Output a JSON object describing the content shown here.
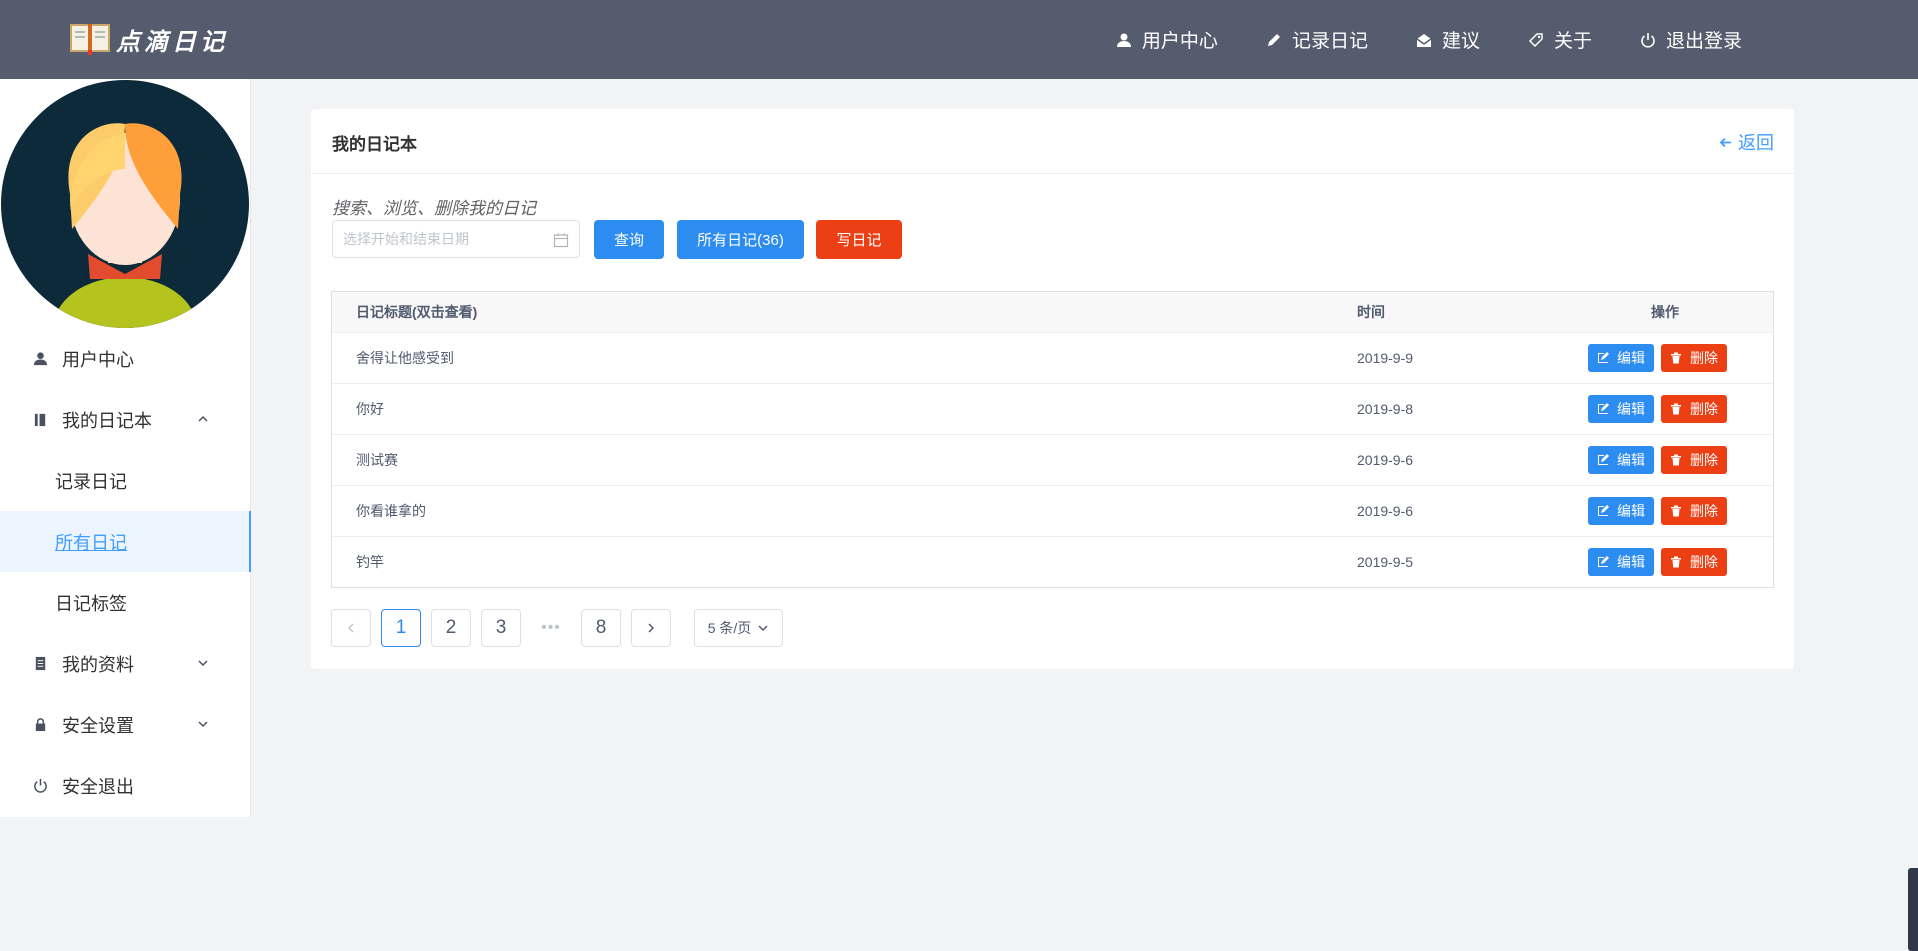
{
  "header": {
    "app_name": "点滴日记",
    "nav": [
      {
        "label": "用户中心",
        "icon": "user-icon"
      },
      {
        "label": "记录日记",
        "icon": "pencil-icon"
      },
      {
        "label": "建议",
        "icon": "mail-open-icon"
      },
      {
        "label": "关于",
        "icon": "tag-icon"
      },
      {
        "label": "退出登录",
        "icon": "power-icon"
      }
    ]
  },
  "sidebar": {
    "items": [
      {
        "label": "用户中心",
        "icon": "user-icon"
      },
      {
        "label": "我的日记本",
        "icon": "book-icon",
        "expanded": true
      },
      {
        "label": "记录日记"
      },
      {
        "label": "所有日记",
        "active": true
      },
      {
        "label": "日记标签"
      },
      {
        "label": "我的资料",
        "icon": "notebook-icon",
        "expanded": false
      },
      {
        "label": "安全设置",
        "icon": "lock-icon",
        "expanded": false
      },
      {
        "label": "安全退出",
        "icon": "power-icon"
      }
    ]
  },
  "main": {
    "title": "我的日记本",
    "back_label": "返回",
    "hint": "搜索、浏览、删除我的日记",
    "date_placeholder": "选择开始和结束日期",
    "query_label": "查询",
    "all_label": "所有日记(36)",
    "write_label": "写日记",
    "table": {
      "columns": [
        "日记标题(双击查看)",
        "时间",
        "操作"
      ],
      "edit_label": "编辑",
      "delete_label": "删除",
      "rows": [
        {
          "title": "舍得让他感受到",
          "time": "2019-9-9"
        },
        {
          "title": "你好",
          "time": "2019-9-8"
        },
        {
          "title": "测试赛",
          "time": "2019-9-6"
        },
        {
          "title": "你看谁拿的",
          "time": "2019-9-6"
        },
        {
          "title": "钓竿",
          "time": "2019-9-5"
        }
      ]
    },
    "pagination": {
      "pages": [
        "1",
        "2",
        "3",
        "•••",
        "8"
      ],
      "current": "1",
      "page_size": "5 条/页"
    }
  },
  "colors": {
    "header_bg": "#545c6e",
    "primary": "#2d8cf0",
    "danger": "#ed3f14",
    "active_text": "#409eff"
  }
}
